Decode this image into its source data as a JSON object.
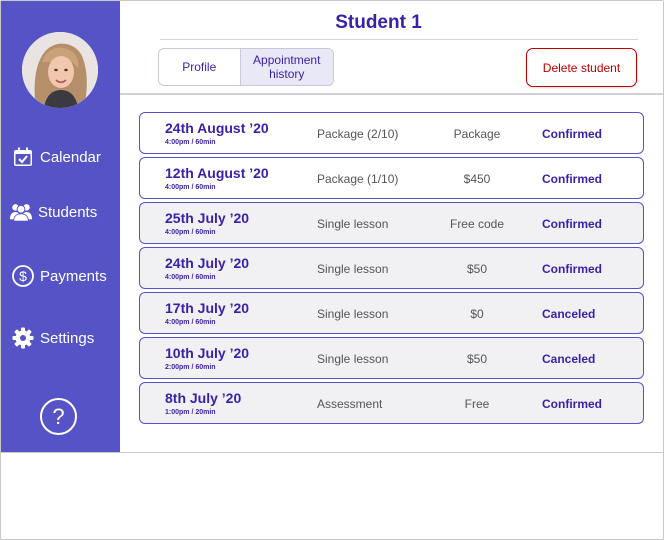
{
  "colors": {
    "sidebar": "#5553c5",
    "accent": "#3b1fa8",
    "danger": "#c00000",
    "row_bg": "#f1f1f4"
  },
  "sidebar": {
    "avatar_icon": "student-avatar",
    "items": [
      {
        "label": "Calendar",
        "icon": "calendar-icon"
      },
      {
        "label": "Students",
        "icon": "students-icon"
      },
      {
        "label": "Payments",
        "icon": "dollar-icon"
      },
      {
        "label": "Settings",
        "icon": "gear-icon"
      }
    ],
    "help_label": "?"
  },
  "header": {
    "title": "Student 1",
    "tabs": [
      {
        "label": "Profile",
        "active": false
      },
      {
        "label": "Appointment history",
        "active": true
      }
    ],
    "delete_label": "Delete student"
  },
  "appointments": [
    {
      "date": "24th August ’20",
      "time": "4:00pm / 60min",
      "type": "Package (2/10)",
      "price": "Package",
      "status": "Confirmed"
    },
    {
      "date": "12th August ’20",
      "time": "4:00pm / 60min",
      "type": "Package (1/10)",
      "price": "$450",
      "status": "Confirmed"
    },
    {
      "date": "25th July ’20",
      "time": "4:00pm / 60min",
      "type": "Single lesson",
      "price": "Free code",
      "status": "Confirmed"
    },
    {
      "date": "24th July ’20",
      "time": "4:00pm / 60min",
      "type": "Single lesson",
      "price": "$50",
      "status": "Confirmed"
    },
    {
      "date": "17th July ’20",
      "time": "4:00pm / 60min",
      "type": "Single lesson",
      "price": "$0",
      "status": "Canceled"
    },
    {
      "date": "10th July ’20",
      "time": "2:00pm / 60min",
      "type": "Single lesson",
      "price": "$50",
      "status": "Canceled"
    },
    {
      "date": "8th July ’20",
      "time": "1:00pm / 20min",
      "type": "Assessment",
      "price": "Free",
      "status": "Confirmed"
    }
  ]
}
